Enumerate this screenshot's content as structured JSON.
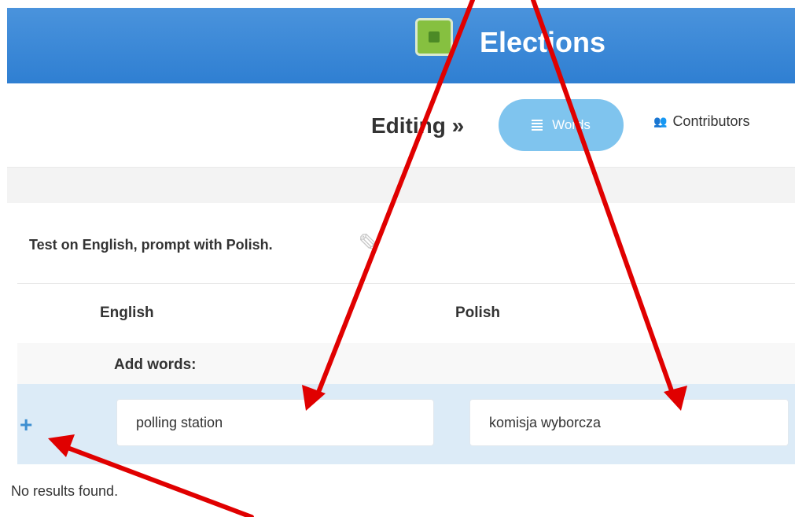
{
  "header": {
    "app_title": "Elections",
    "logo_icon": "elections-logo-icon",
    "background": "#3a88d6"
  },
  "subnav": {
    "editing_label": "Editing »",
    "tabs": [
      {
        "label": "Words",
        "icon": "list-icon",
        "active": true,
        "color": "#7fc4ee"
      },
      {
        "label": "Contributors",
        "icon": "group-icon",
        "active": false
      }
    ]
  },
  "test": {
    "description": "Test on English, prompt with Polish.",
    "edit_icon": "pencil-icon"
  },
  "table": {
    "columns": [
      "English",
      "Polish"
    ],
    "add_words_label": "Add words:",
    "add_icon": "plus-icon",
    "inputs": {
      "english_value": "polling station",
      "polish_value": "komisja wyborcza"
    },
    "row_highlight_color": "#dcebf7",
    "empty_message": "No results found."
  },
  "annotations": {
    "arrow_color": "#e00000"
  }
}
